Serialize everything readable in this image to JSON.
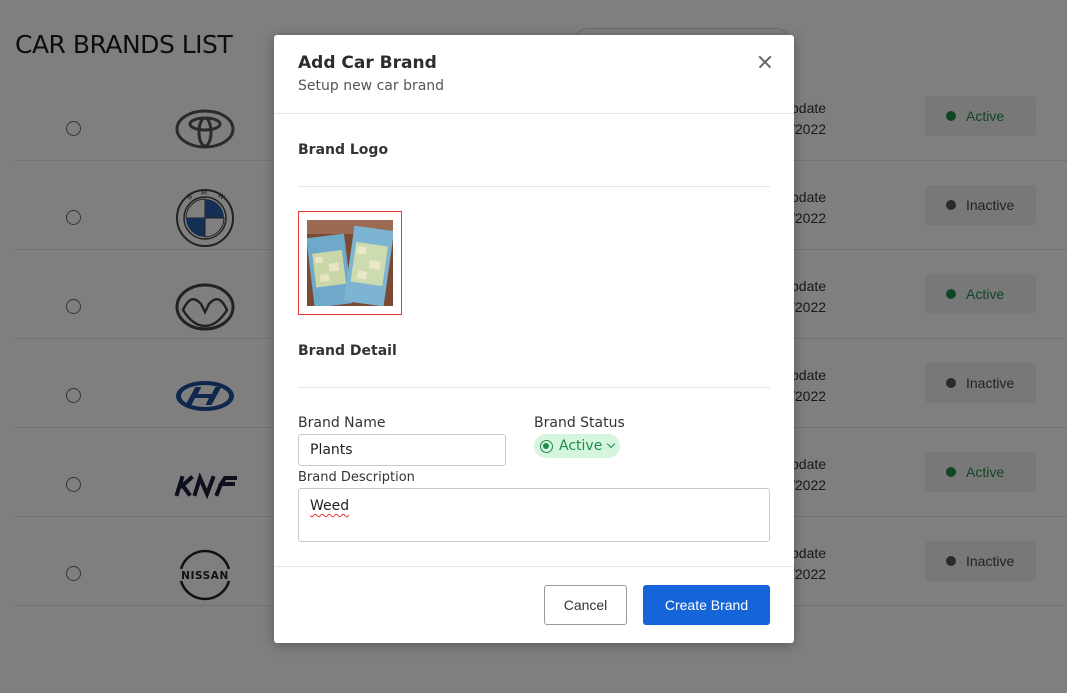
{
  "page": {
    "title": "CAR BRANDS LIST",
    "rows": [
      {
        "brand_icon": "toyota-logo-icon",
        "update_label": "pdate",
        "date": "/2022",
        "status": "Active"
      },
      {
        "brand_icon": "bmw-logo-icon",
        "update_label": "pdate",
        "date": "/2022",
        "status": "Inactive"
      },
      {
        "brand_icon": "mazda-logo-icon",
        "update_label": "pdate",
        "date": "/2022",
        "status": "Active"
      },
      {
        "brand_icon": "hyundai-logo-icon",
        "update_label": "pdate",
        "date": "/2022",
        "status": "Inactive"
      },
      {
        "brand_icon": "kia-logo-icon",
        "update_label": "pdate",
        "date": "/2022",
        "status": "Active"
      },
      {
        "brand_icon": "nissan-logo-icon",
        "update_label": "pdate",
        "date": "/2022",
        "status": "Inactive"
      }
    ]
  },
  "modal": {
    "title": "Add Car Brand",
    "subtitle": "Setup new car brand",
    "logo_section": "Brand Logo",
    "detail_section": "Brand Detail",
    "name_label": "Brand Name",
    "name_value": "Plants",
    "status_label": "Brand Status",
    "status_value": "Active",
    "description_label": "Brand Description",
    "description_value": "Weed",
    "cancel_label": "Cancel",
    "create_label": "Create Brand"
  },
  "colors": {
    "primary": "#1565d8",
    "active_green": "#1e8c4a",
    "error_red": "#e53935",
    "overlay": "rgba(0,0,0,0.5)"
  }
}
